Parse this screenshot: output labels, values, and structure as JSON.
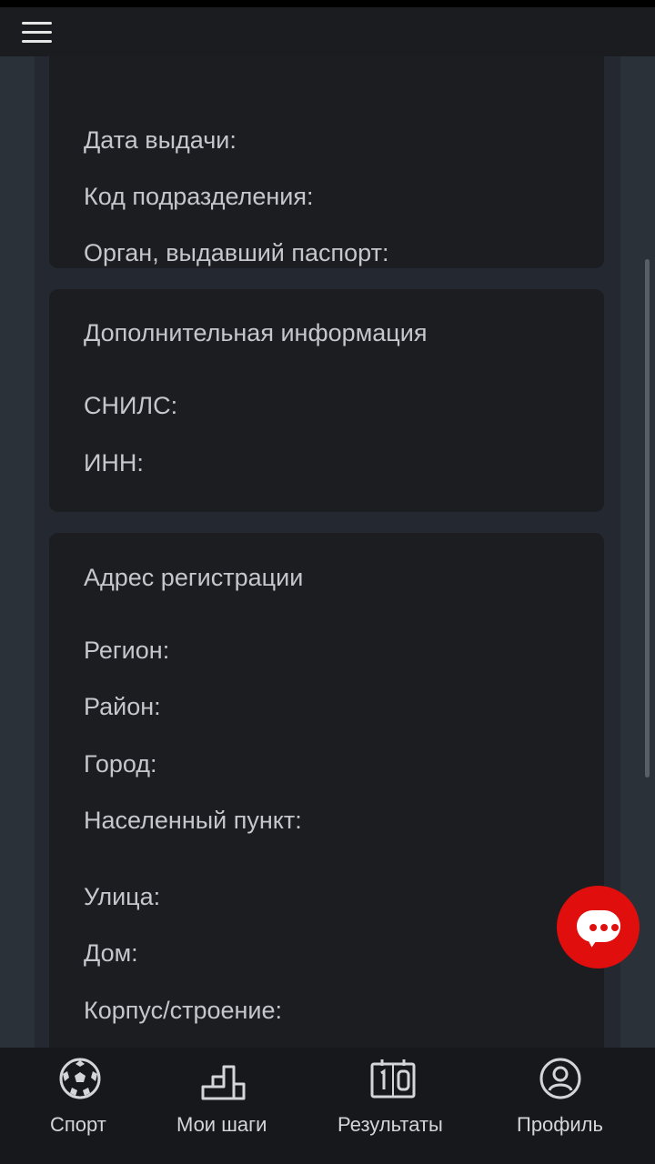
{
  "header": {
    "menu_icon": "hamburger-menu-icon"
  },
  "passport": {
    "fields": [
      "Дата выдачи:",
      "Код подразделения:",
      "Орган, выдавший паспорт:"
    ]
  },
  "additional_info": {
    "title": "Дополнительная информация",
    "fields": [
      "СНИЛС:",
      "ИНН:"
    ]
  },
  "registration_address": {
    "title": "Адрес регистрации",
    "fields": [
      "Регион:",
      "Район:",
      "Город:",
      "Населенный пункт:",
      "Улица:",
      "Дом:",
      "Корпус/строение:"
    ]
  },
  "chat": {
    "icon": "chat-bubble-icon",
    "accent": "#e10e0e"
  },
  "bottom_nav": {
    "items": [
      {
        "label": "Спорт",
        "icon": "soccer-ball-icon"
      },
      {
        "label": "Мои шаги",
        "icon": "steps-icon"
      },
      {
        "label": "Результаты",
        "icon": "scoreboard-icon"
      },
      {
        "label": "Профиль",
        "icon": "profile-icon"
      }
    ]
  }
}
